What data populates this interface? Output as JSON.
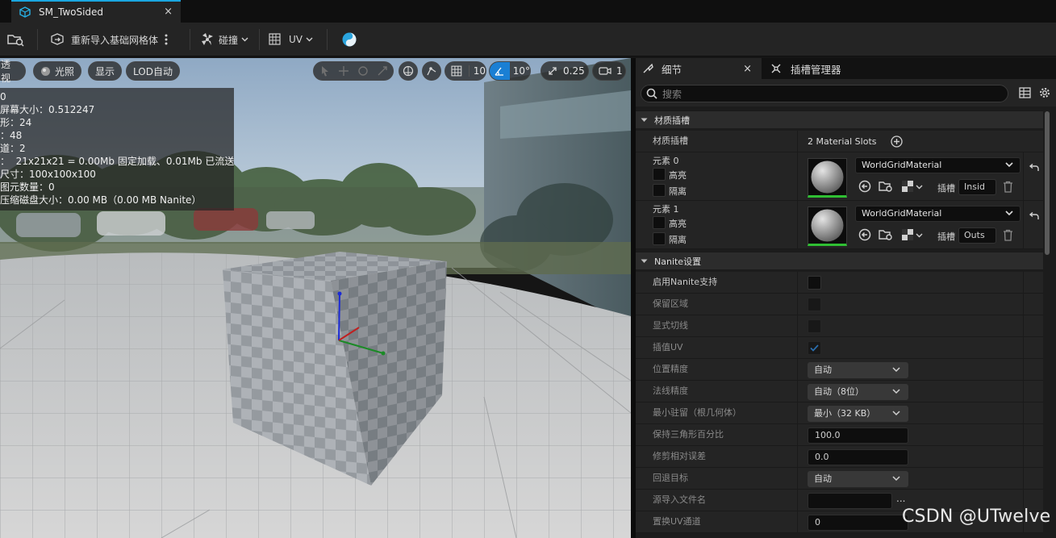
{
  "tab": {
    "title": "SM_TwoSided",
    "close": "×"
  },
  "toolbar": {
    "reimport": "重新导入基础网格体",
    "collision": "碰撞",
    "uv": "UV"
  },
  "viewport": {
    "perspective": "透视",
    "lit": "光照",
    "show": "显示",
    "lod": "LOD自动",
    "grid_snap": "10",
    "rot_snap": "10°",
    "scale_snap": "0.25",
    "cam_speed": "1",
    "stats": [
      "0",
      "屏幕大小：0.512247",
      "形：24",
      "：48",
      "道：2",
      "：  21x21x21 = 0.00Mb 固定加载、0.01Mb 已流送",
      "尺寸：100x100x100",
      "图元数量：0",
      "压缩磁盘大小：0.00 MB（0.00 MB Nanite）"
    ]
  },
  "panel": {
    "tab_details": "细节",
    "tab_slots": "插槽管理器",
    "search_placeholder": "搜索",
    "section_materials": "材质插槽",
    "slots_label": "材质插槽",
    "slots_count": "2 Material Slots",
    "elements": [
      {
        "name": "元素 0",
        "highlight": "高亮",
        "isolate": "隔离",
        "material": "WorldGridMaterial",
        "slot_label": "插槽",
        "slot_name": "Insid"
      },
      {
        "name": "元素 1",
        "highlight": "高亮",
        "isolate": "隔离",
        "material": "WorldGridMaterial",
        "slot_label": "插槽",
        "slot_name": "Outs"
      }
    ],
    "section_nanite": "Nanite设置",
    "rows": {
      "enable": "启用Nanite支持",
      "preserve": "保留区域",
      "explicit": "显式切线",
      "lerp_uv": "插值UV",
      "pos_precision": "位置精度",
      "pos_precision_val": "自动",
      "normal_precision": "法线精度",
      "normal_precision_val": "自动（8位）",
      "min_resident": "最小驻留（根几何体）",
      "min_resident_val": "最小（32 KB）",
      "keep_tri": "保持三角形百分比",
      "keep_tri_val": "100.0",
      "trim_error": "修剪相对误差",
      "trim_error_val": "0.0",
      "fallback": "回退目标",
      "fallback_val": "自动",
      "source_file": "源导入文件名",
      "source_file_more": "...",
      "replace_uv": "置换UV通道",
      "replace_uv_val": "0"
    }
  },
  "colors": {
    "accent": "#1aa6e0",
    "green": "#2fbf33",
    "bg": "#1c1c1c"
  },
  "watermark": "CSDN @UTwelve"
}
